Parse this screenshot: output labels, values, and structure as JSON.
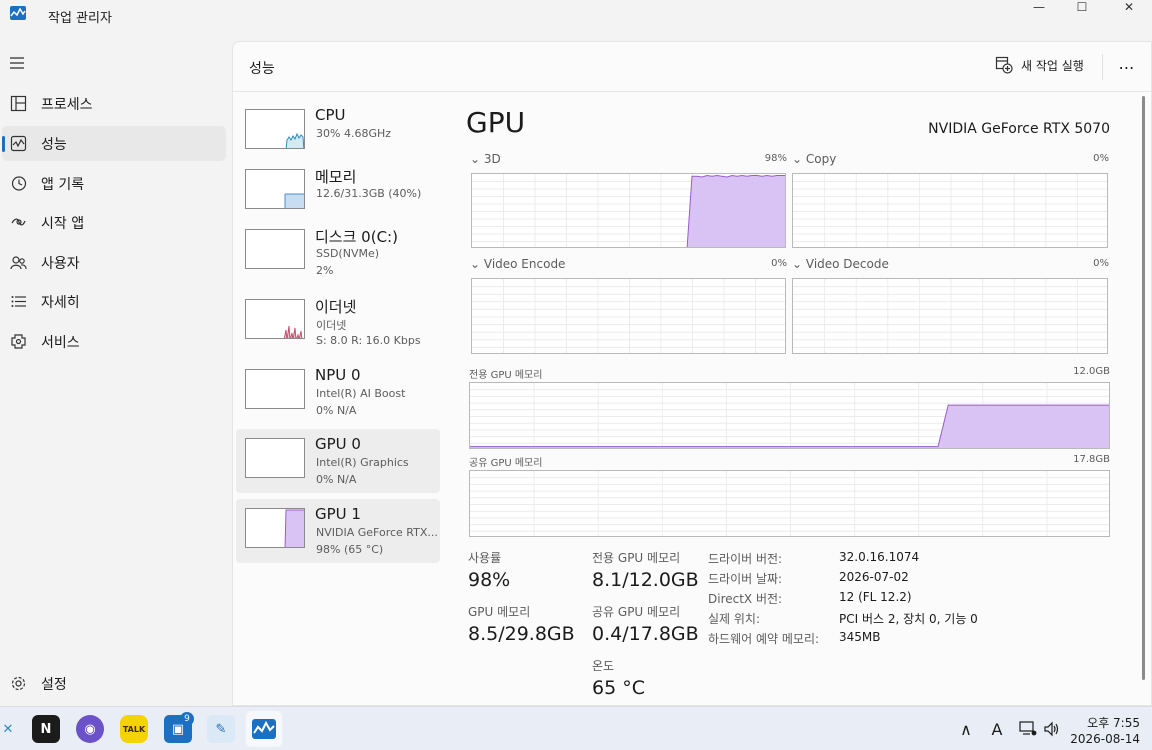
{
  "window": {
    "title": "작업 관리자",
    "minimize_glyph": "—",
    "maximize_glyph": "☐",
    "close_glyph": "✕"
  },
  "nav": {
    "items": [
      {
        "label": "프로세스",
        "icon": "processes-icon"
      },
      {
        "label": "성능",
        "icon": "performance-icon"
      },
      {
        "label": "앱 기록",
        "icon": "app-history-icon"
      },
      {
        "label": "시작 앱",
        "icon": "startup-apps-icon"
      },
      {
        "label": "사용자",
        "icon": "users-icon"
      },
      {
        "label": "자세히",
        "icon": "details-icon"
      },
      {
        "label": "서비스",
        "icon": "services-icon"
      }
    ],
    "settings_label": "설정",
    "selected": "성능"
  },
  "header": {
    "title": "성능",
    "new_task_label": "새 작업 실행",
    "more_glyph": "⋯"
  },
  "resources": [
    {
      "name": "CPU",
      "line1": "30% 4.68GHz",
      "line2": ""
    },
    {
      "name": "메모리",
      "line1": "12.6/31.3GB (40%)",
      "line2": ""
    },
    {
      "name": "디스크 0(C:)",
      "line1": "SSD(NVMe)",
      "line2": "2%"
    },
    {
      "name": "이더넷",
      "line1": "이더넷",
      "line2": "S: 8.0  R: 16.0 Kbps"
    },
    {
      "name": "NPU 0",
      "line1": "Intel(R) AI Boost",
      "line2": "0%  N/A"
    },
    {
      "name": "GPU 0",
      "line1": "Intel(R) Graphics",
      "line2": "0%  N/A"
    },
    {
      "name": "GPU 1",
      "line1": "NVIDIA GeForce RTX...",
      "line2": "98% (65 °C)"
    }
  ],
  "gpu": {
    "title": "GPU",
    "model": "NVIDIA GeForce RTX 5070",
    "engines": [
      {
        "label": "3D",
        "percent": "98%"
      },
      {
        "label": "Copy",
        "percent": "0%"
      },
      {
        "label": "Video Encode",
        "percent": "0%"
      },
      {
        "label": "Video Decode",
        "percent": "0%"
      }
    ],
    "dedicated_memory_label": "전용 GPU 메모리",
    "dedicated_memory_max": "12.0GB",
    "shared_memory_label": "공유 GPU 메모리",
    "shared_memory_max": "17.8GB",
    "stats": {
      "utilization_label": "사용률",
      "utilization_value": "98%",
      "gpu_memory_label": "GPU 메모리",
      "gpu_memory_value": "8.5/29.8GB",
      "dedicated_label": "전용 GPU 메모리",
      "dedicated_value": "8.1/12.0GB",
      "shared_label": "공유 GPU 메모리",
      "shared_value": "0.4/17.8GB",
      "temperature_label": "온도",
      "temperature_value": "65 °C"
    },
    "info": [
      {
        "key": "드라이버 버전:",
        "value": "32.0.16.1074"
      },
      {
        "key": "드라이버 날짜:",
        "value": "2026-07-02"
      },
      {
        "key": "DirectX 버전:",
        "value": "12 (FL 12.2)"
      },
      {
        "key": "실제 위치:",
        "value": "PCI 버스 2, 장치 0, 기능 0"
      },
      {
        "key": "하드웨어 예약 메모리:",
        "value": "345MB"
      }
    ]
  },
  "taskbar": {
    "apps": [
      {
        "name": "notion-app",
        "glyph": "N"
      },
      {
        "name": "discord-app",
        "glyph": "◉"
      },
      {
        "name": "kakaotalk-app",
        "glyph": "TALK"
      },
      {
        "name": "messenger-app",
        "glyph": "▣"
      },
      {
        "name": "paint-app",
        "glyph": "✎"
      },
      {
        "name": "task-manager-app",
        "glyph": ""
      }
    ],
    "badge_count": "9",
    "tray_chevron": "∧",
    "tray_ime": "A",
    "clock_time": "오후 7:55",
    "clock_date": "2026-08-14"
  },
  "colors": {
    "accent": "#1c6fc1",
    "gpu_fill": "#d9c3f5",
    "gpu_line": "#9b59d0",
    "cpu_line": "#2a8bbf",
    "memory_fill": "#c8dcf2",
    "ethernet_line": "#c0506a"
  },
  "graph_series": {
    "gpu_3d": [
      0,
      0,
      0,
      0,
      0,
      0,
      0,
      0,
      0,
      0,
      0,
      0,
      0,
      0,
      0,
      0,
      0,
      0,
      0,
      0,
      0,
      0,
      0,
      0,
      0,
      0,
      0,
      0,
      0,
      0,
      0,
      0,
      0,
      0,
      0,
      0,
      0,
      0,
      0,
      0,
      0,
      0,
      0,
      0,
      97,
      97,
      96,
      98,
      97,
      98,
      97,
      96,
      98,
      97,
      98,
      97,
      98,
      98,
      97,
      98,
      97,
      98,
      98,
      98
    ],
    "gpu_dedicated_pct": [
      5,
      5,
      5,
      5,
      5,
      5,
      5,
      5,
      5,
      5,
      5,
      5,
      5,
      5,
      5,
      5,
      5,
      5,
      5,
      5,
      5,
      5,
      5,
      5,
      5,
      5,
      5,
      5,
      5,
      5,
      5,
      5,
      5,
      5,
      5,
      5,
      5,
      5,
      5,
      5,
      5,
      5,
      5,
      5,
      5,
      5,
      5,
      67,
      67,
      67,
      67,
      67,
      67,
      67,
      67,
      67,
      67,
      67,
      67,
      67,
      67,
      67,
      67,
      67
    ],
    "gpu_shared_pct": [
      0,
      0,
      0,
      0,
      0,
      0,
      0,
      0,
      0,
      0,
      0,
      0,
      0,
      0,
      0,
      0,
      0,
      0,
      0,
      0,
      0,
      0,
      0,
      0,
      0,
      0,
      0,
      0,
      0,
      0,
      0,
      0,
      0,
      0,
      0,
      0,
      0,
      0,
      0,
      0,
      0,
      0,
      0,
      0,
      0,
      0,
      0,
      2,
      2,
      2,
      2,
      2,
      2,
      2,
      2,
      2,
      2,
      2,
      2,
      2,
      2,
      2,
      2,
      2
    ]
  }
}
